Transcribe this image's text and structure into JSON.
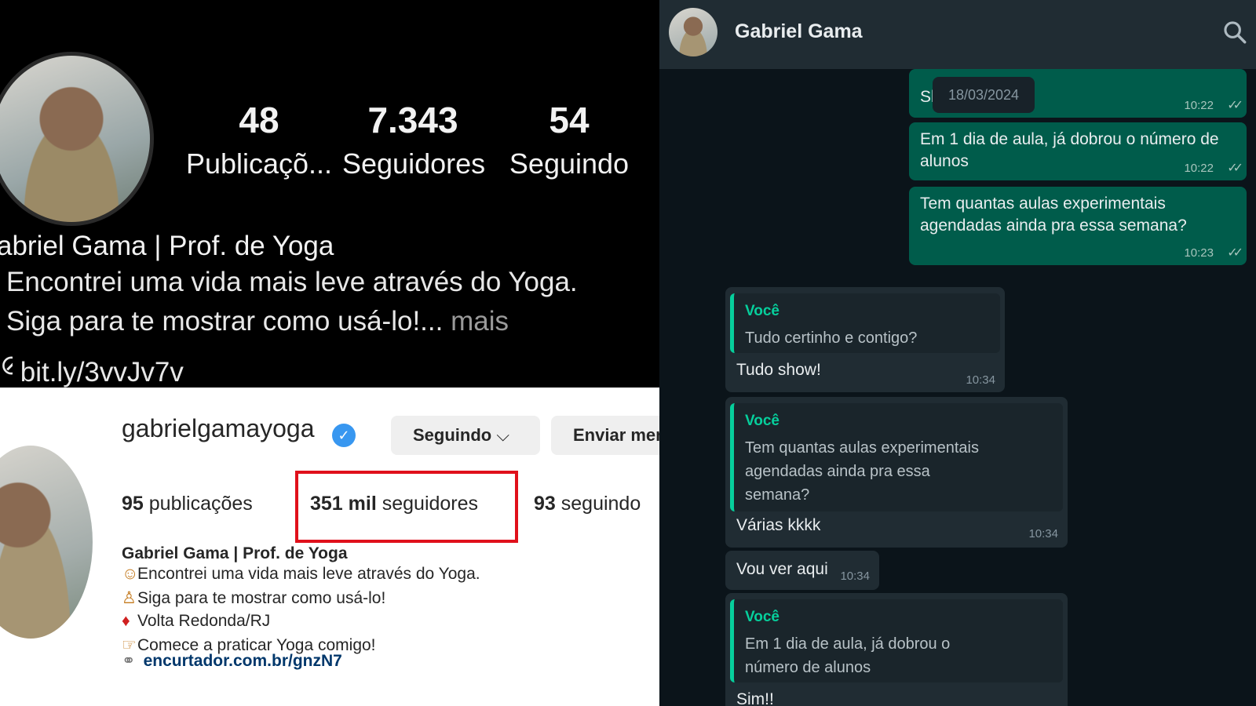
{
  "ig_mobile": {
    "stats": [
      {
        "value": "48",
        "label": "Publicaçõ..."
      },
      {
        "value": "7.343",
        "label": "Seguidores"
      },
      {
        "value": "54",
        "label": "Seguindo"
      }
    ],
    "name": "abriel Gama | Prof. de Yoga",
    "bio_line1": "Encontrei uma vida mais leve através do Yoga.",
    "bio_line2": "Siga para te mostrar como usá-lo!...",
    "more": "mais",
    "link": "bit.ly/3vvJv7v"
  },
  "ig_desktop": {
    "username": "gabrielgamayoga",
    "following_button": "Seguindo",
    "message_button": "Enviar men",
    "posts_num": "95",
    "posts_label": "publicações",
    "followers_num": "351 mil",
    "followers_label": "seguidores",
    "following_num": "93",
    "following_label": "seguindo",
    "bio_name": "Gabriel Gama | Prof. de Yoga",
    "bio_lines": [
      "Encontrei uma vida mais leve através do Yoga.",
      "Siga para te mostrar como usá-lo!",
      "Volta Redonda/RJ",
      "Comece a praticar Yoga comigo!"
    ],
    "link": "encurtador.com.br/gnzN7",
    "highlight_color": "#e0101b"
  },
  "whatsapp": {
    "contact_name": "Gabriel Gama",
    "date_chip": "18/03/2024",
    "messages": [
      {
        "direction": "out",
        "text": "Sh",
        "time": "10:22"
      },
      {
        "direction": "out",
        "text_line1": "Em 1 dia de aula, já dobrou o número de",
        "text_line2": "alunos",
        "time": "10:22"
      },
      {
        "direction": "out",
        "text_line1": "Tem quantas aulas experimentais",
        "text_line2": "agendadas ainda pra essa semana?",
        "time": "10:23"
      },
      {
        "direction": "in",
        "quote_author": "Você",
        "quote": "Tudo certinho e contigo?",
        "text": "Tudo show!",
        "time": "10:34"
      },
      {
        "direction": "in",
        "quote_author": "Você",
        "quote_line1": "Tem quantas aulas experimentais",
        "quote_line2": "agendadas ainda pra essa",
        "quote_line3": "semana?",
        "text": "Várias kkkk",
        "time": "10:34"
      },
      {
        "direction": "in",
        "text": "Vou ver aqui",
        "time": "10:34"
      },
      {
        "direction": "in",
        "quote_author": "Você",
        "quote_line1": "Em 1 dia de aula, já dobrou o",
        "quote_line2": "número de alunos",
        "text": "Sim!!"
      }
    ],
    "colors": {
      "outgoing": "#005c4b",
      "incoming": "#202c33",
      "accent": "#06cf9c"
    }
  }
}
